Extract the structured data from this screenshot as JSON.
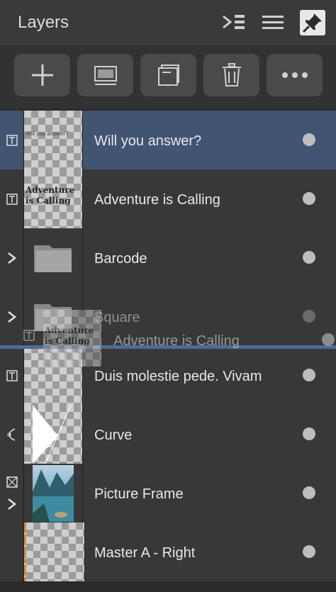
{
  "header": {
    "title": "Layers"
  },
  "toolbar": {
    "buttons": [
      "add",
      "mask",
      "group",
      "delete",
      "more"
    ]
  },
  "layers": [
    {
      "name": "Will you answer?",
      "type": "text",
      "selected": true,
      "thumb_text": "Will you answer?"
    },
    {
      "name": "Adventure is Calling",
      "type": "text",
      "thumb_text": "Adventure is Calling"
    },
    {
      "name": "Barcode",
      "type": "group"
    },
    {
      "name": "Square",
      "type": "group"
    },
    {
      "name": "Duis molestie pede. Vivam",
      "type": "text"
    },
    {
      "name": "Curve",
      "type": "curve"
    },
    {
      "name": "Picture Frame",
      "type": "frame"
    },
    {
      "name": "Master A - Right",
      "type": "master"
    }
  ],
  "drag": {
    "name": "Adventure is Calling",
    "thumb_text": "Adventure is Calling"
  },
  "colors": {
    "selected": "#415472",
    "header": "#3a3a3a",
    "row": "#383838"
  }
}
